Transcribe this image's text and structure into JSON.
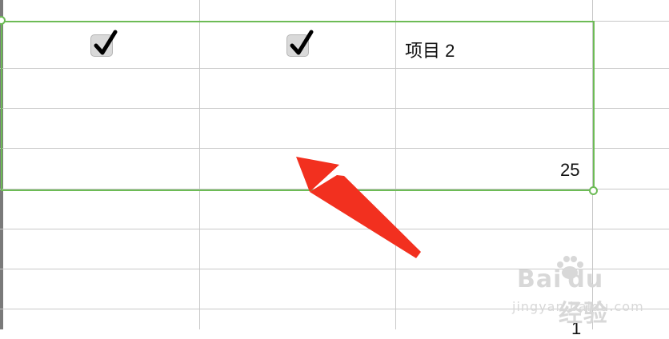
{
  "cells": {
    "r1_c1_checked": true,
    "r1_c2_checked": true,
    "r1_c3_text": "项目 2",
    "r4_c3_value": "25",
    "bottom_partial_value": "1"
  },
  "watermark": {
    "brand": "Bai du",
    "brand_suffix": "经验",
    "url": "jingyan.baidu.com"
  },
  "colors": {
    "selection": "#6dbb56",
    "arrow": "#f2301f",
    "grid": "#c8c8c8"
  },
  "icons": {
    "checkmark": "check-icon",
    "arrow": "red-arrow-annotation"
  }
}
